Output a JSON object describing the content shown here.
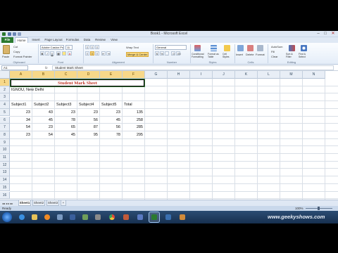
{
  "window": {
    "title": "Book1 - Microsoft Excel",
    "minimize": "–",
    "maximize": "□",
    "close": "✕"
  },
  "ribbon_tabs": [
    "File",
    "Home",
    "Insert",
    "Page Layout",
    "Formulas",
    "Data",
    "Review",
    "View"
  ],
  "ribbon": {
    "clipboard": {
      "cut": "Cut",
      "copy": "Copy",
      "format_painter": "Format Painter",
      "paste": "Paste",
      "label": "Clipboard"
    },
    "font": {
      "name": "Adobe Caslon Pro",
      "size": "11",
      "label": "Font"
    },
    "alignment": {
      "wrap_text": "Wrap Text",
      "merge_center": "Merge & Center",
      "label": "Alignment"
    },
    "number": {
      "format": "General",
      "label": "Number"
    },
    "styles": {
      "conditional": "Conditional Formatting",
      "format_table": "Format as Table",
      "cell_styles": "Cell Styles",
      "label": "Styles"
    },
    "cells": {
      "insert": "Insert",
      "delete": "Delete",
      "format": "Format",
      "label": "Cells"
    },
    "editing": {
      "autosum": "AutoSum",
      "fill": "Fill",
      "clear": "Clear",
      "sort": "Sort & Filter",
      "find": "Find & Select",
      "label": "Editing"
    }
  },
  "formula_bar": {
    "name_box": "A1",
    "fx": "fx",
    "content": "Student Mark Sheet"
  },
  "columns": [
    "A",
    "B",
    "C",
    "D",
    "E",
    "F",
    "G",
    "H",
    "I",
    "J",
    "K",
    "L",
    "M",
    "N"
  ],
  "rows": [
    "1",
    "2",
    "3",
    "4",
    "5",
    "6",
    "7",
    "8",
    "9",
    "10",
    "11",
    "12",
    "13",
    "14",
    "15",
    "16"
  ],
  "sheet": {
    "title_cell": "Student Mark Sheet",
    "a2": "IGNOU, New Delhi",
    "headers": [
      "Subject1",
      "Subject2",
      "Subject3",
      "Subject4",
      "Subject5",
      "Total"
    ],
    "data": [
      [
        "23",
        "43",
        "23",
        "23",
        "23",
        "135"
      ],
      [
        "34",
        "45",
        "78",
        "56",
        "45",
        "258"
      ],
      [
        "54",
        "23",
        "65",
        "87",
        "56",
        "285"
      ],
      [
        "23",
        "54",
        "45",
        "95",
        "78",
        "295"
      ]
    ]
  },
  "sheet_tabs": [
    "Sheet1",
    "Sheet2",
    "Sheet3"
  ],
  "status": {
    "left": "Ready",
    "zoom": "100%"
  },
  "watermark": "www.geekyshows.com",
  "colors": {
    "title_text": "#c0392b",
    "file_tab": "#2a7a2f",
    "selection_header": "#f7d889"
  }
}
